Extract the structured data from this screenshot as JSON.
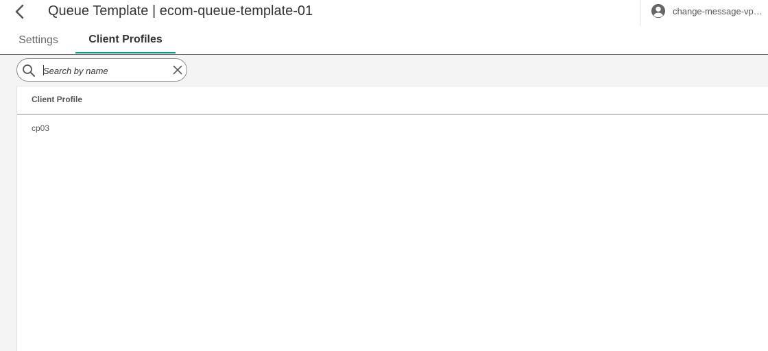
{
  "header": {
    "title": "Queue Template | ecom-queue-template-01",
    "user": "change-message-vpn-user",
    "back_icon": "chevron-left-icon",
    "user_icon": "account-circle-icon"
  },
  "tabs": [
    {
      "label": "Settings",
      "active": false
    },
    {
      "label": "Client Profiles",
      "active": true
    }
  ],
  "search": {
    "placeholder": "Search by name",
    "value": "",
    "icon": "search-icon",
    "clear_icon": "close-icon"
  },
  "table": {
    "columns": [
      "Client Profile"
    ],
    "rows": [
      {
        "client_profile": "cp03"
      }
    ]
  },
  "colors": {
    "accent": "#00a38b",
    "content_bg": "#f4f4f4"
  }
}
